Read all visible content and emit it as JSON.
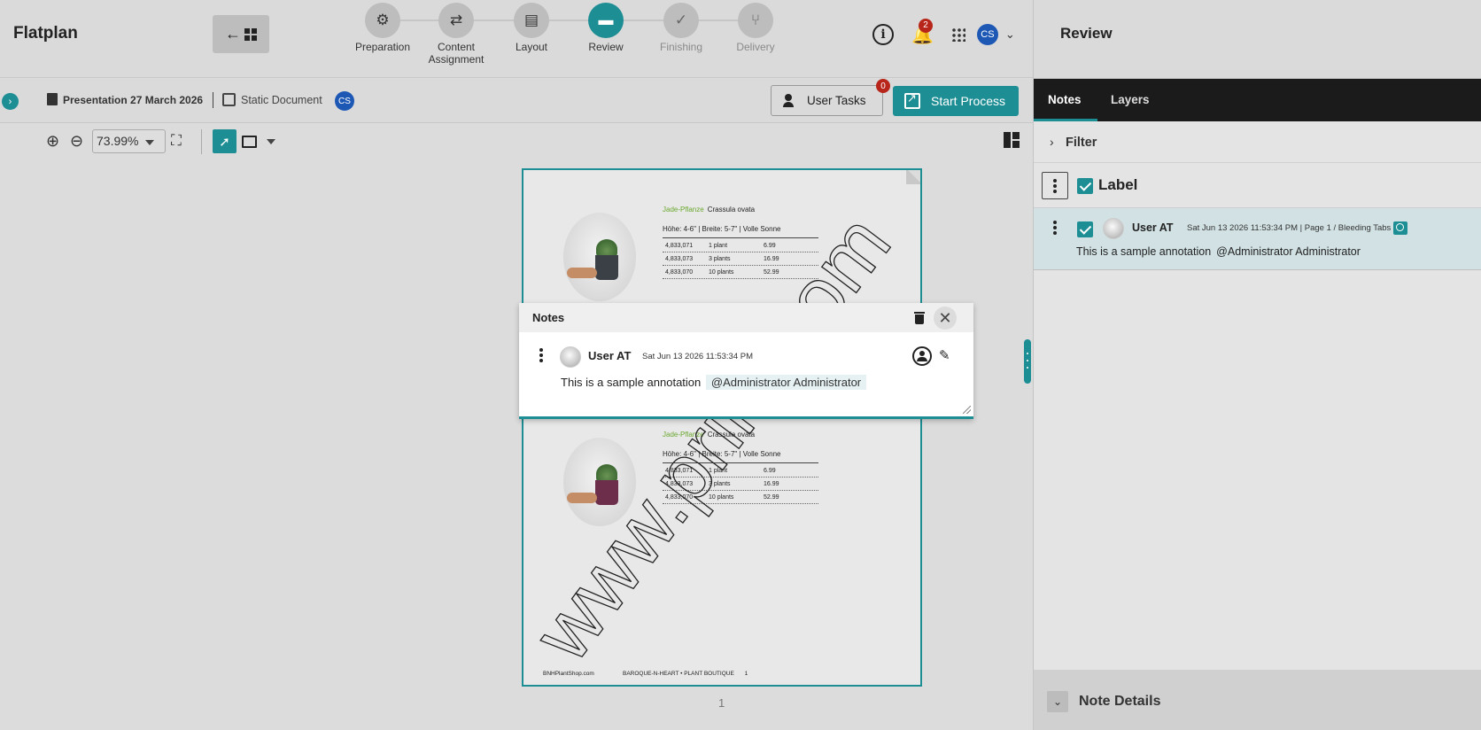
{
  "app": {
    "title": "Flatplan"
  },
  "stepper": {
    "steps": [
      {
        "label": "Preparation",
        "icon": "gear-icon"
      },
      {
        "label": "Content Assignment",
        "icon": "swap-icon"
      },
      {
        "label": "Layout",
        "icon": "layout-icon"
      },
      {
        "label": "Review",
        "icon": "comment-icon",
        "active": true
      },
      {
        "label": "Finishing",
        "icon": "check-icon"
      },
      {
        "label": "Delivery",
        "icon": "share-icon"
      }
    ]
  },
  "header": {
    "notifications_count": "2",
    "avatar_initials": "CS"
  },
  "document": {
    "title": "Presentation 27 March 2026",
    "type": "Static Document",
    "avatar_initials": "CS"
  },
  "actions": {
    "user_tasks_label": "User Tasks",
    "user_tasks_count": "0",
    "start_process_label": "Start Process"
  },
  "toolbar": {
    "zoom": "73.99%"
  },
  "page": {
    "products": [
      {
        "name": "Jade-Pflanze",
        "latin": "Crassula ovata",
        "dims": "Höhe: 4-6\" | Breite: 5-7\" | Volle Sonne",
        "rows": [
          [
            "4,833,071",
            "1 plant",
            "6.99"
          ],
          [
            "4,833,073",
            "3 plants",
            "16.99"
          ],
          [
            "4,833,070",
            "10 plants",
            "52.99"
          ]
        ],
        "pot_color": "#3b3f46"
      },
      {
        "name": "Jade-Pflanze",
        "latin": "Crassula ovata",
        "dims": "Höhe: 4-6\" | Breite: 5-7\" | Volle Sonne",
        "rows": [
          [
            "4,833,071",
            "1 plant",
            "6.99"
          ],
          [
            "4,833,073",
            "3 plants",
            "16.99"
          ],
          [
            "4,833,070",
            "10 plants",
            "52.99"
          ]
        ],
        "pot_color": "#6d2e4c"
      }
    ],
    "footer_site": "BNHPlantShop.com",
    "footer_brand": "BAROQUE-N-HEART • PLANT BOUTIQUE",
    "footer_page": "1",
    "watermark": "www.print.com",
    "page_number": "1"
  },
  "notes_popup": {
    "title": "Notes",
    "user": "User AT",
    "date": "Sat Jun 13 2026 11:53:34 PM",
    "text": "This is a sample annotation",
    "mention": "@Administrator Administrator"
  },
  "review_panel": {
    "title": "Review",
    "tabs": [
      "Notes",
      "Layers"
    ],
    "filter_label": "Filter",
    "label_header": "Label",
    "note": {
      "user": "User AT",
      "meta": "Sat Jun 13 2026 11:53:34 PM | Page 1 / Bleeding Tabs",
      "text": "This is a sample annotation",
      "mention": "@Administrator Administrator"
    },
    "details_label": "Note Details"
  },
  "colors": {
    "accent": "#1e8e95",
    "badge": "#b8261b",
    "avatar": "#1e58b5"
  }
}
